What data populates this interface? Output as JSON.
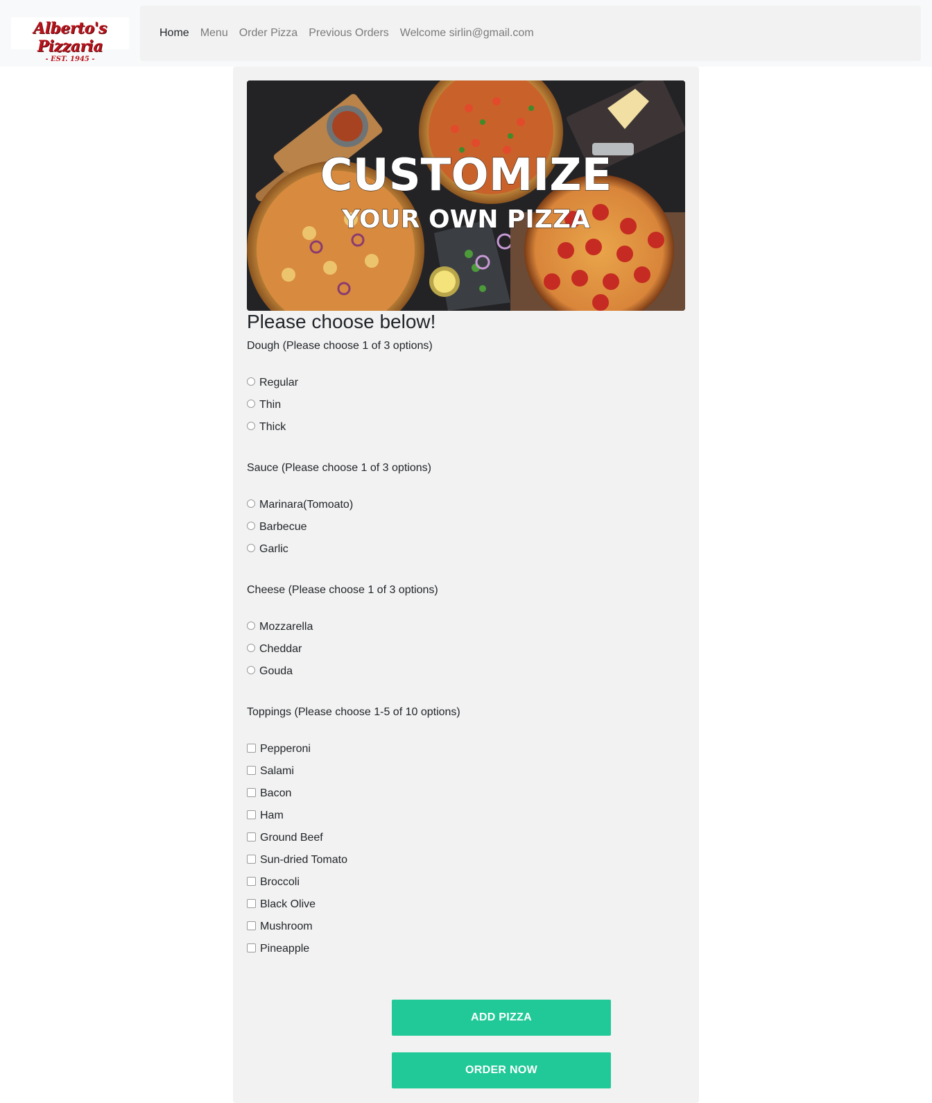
{
  "brand": {
    "name": "Alberto's Pizzaria",
    "tagline": "- EST. 1945 -"
  },
  "nav": {
    "items": [
      "Home",
      "Menu",
      "Order Pizza",
      "Previous Orders",
      "Welcome sirlin@gmail.com"
    ]
  },
  "banner": {
    "title": "CUSTOMIZE",
    "subtitle": "YOUR OWN PIZZA"
  },
  "form": {
    "heading": "Please choose below!",
    "dough": {
      "label": "Dough (Please choose 1 of 3 options)",
      "options": [
        "Regular",
        "Thin",
        "Thick"
      ]
    },
    "sauce": {
      "label": "Sauce (Please choose 1 of 3 options)",
      "options": [
        "Marinara(Tomoato)",
        "Barbecue",
        "Garlic"
      ]
    },
    "cheese": {
      "label": "Cheese (Please choose 1 of 3 options)",
      "options": [
        "Mozzarella",
        "Cheddar",
        "Gouda"
      ]
    },
    "toppings": {
      "label": "Toppings (Please choose 1-5 of 10 options)",
      "options": [
        "Pepperoni",
        "Salami",
        "Bacon",
        "Ham",
        "Ground Beef",
        "Sun-dried Tomato",
        "Broccoli",
        "Black Olive",
        "Mushroom",
        "Pineapple"
      ]
    }
  },
  "actions": {
    "add_label": "ADD PIZZA",
    "order_label": "ORDER NOW"
  },
  "colors": {
    "accent": "#20c997",
    "brand_red": "#b8121b"
  }
}
